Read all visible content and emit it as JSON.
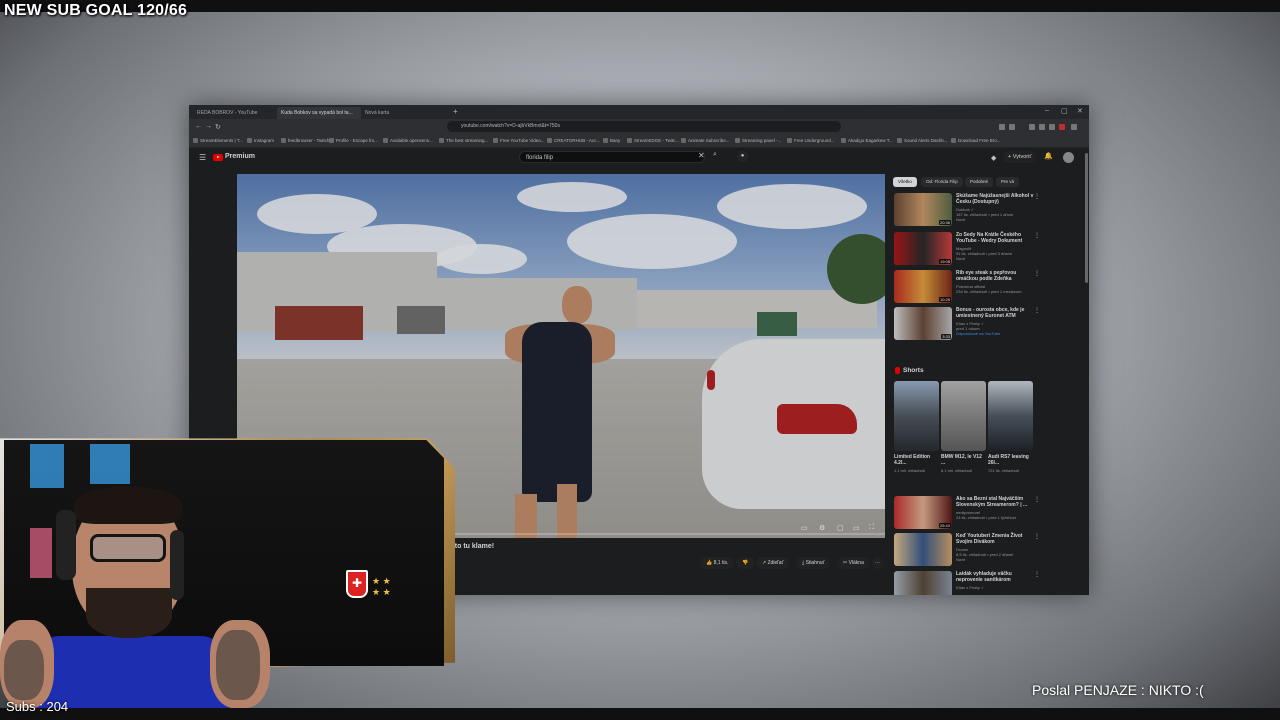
{
  "overlay": {
    "sub_goal": "NEW SUB GOAL 120/66",
    "subs_label": "Subs : 204",
    "donation": "Poslal PENJAZE : NIKTO :("
  },
  "browser": {
    "tabs": [
      "REDA BOBROV - YouTube",
      "Kuda Bobkov sa vypadá bol ta...",
      "Nová karta"
    ],
    "new_tab": "+",
    "window_controls": [
      "–",
      "▢",
      "✕"
    ],
    "url": "youtube.com/watch?v=D-ajbVkBmxt&t=750s",
    "bookmarks": [
      "StreamElements | T...",
      "Instagram",
      "feedbrowser - Twitch",
      "Profile - Escape fro...",
      "Available opensens...",
      "The best streaming...",
      "Free YouTube Video...",
      "CREATORHUB - Acc...",
      "Bany",
      "StreamEDGE - Twitc...",
      "Animate Subscribe...",
      "Streaming panel -...",
      "Free Underground...",
      "Akadigo Eagarkew T...",
      "Sound Alerts Dashb...",
      "Download Free Bro..."
    ]
  },
  "youtube": {
    "premium_label": "Premium",
    "search_value": "florida filip",
    "create_label": "+ Vytvoriť",
    "video_title": "ekto tu klame!",
    "actions": [
      "👍 8,1 tis.",
      "👎",
      "↗ Zdieľať",
      "⤓ Stiahnuť",
      "✂ Vlákna",
      "⋯"
    ],
    "chips": [
      "Všetko",
      "Od: Florida Filip",
      "Podobné",
      "Pre vá"
    ],
    "recommendations": [
      {
        "title": "Skúšame Najúžasnejší Alkohol v Česku (Dostupný)",
        "channel": "Dobkok ✓",
        "meta": "187 tis. zhliadnutí • pred 1 dňom",
        "badge": "Nové",
        "duration": "20:36"
      },
      {
        "title": "Zo Sedy Na Krátle Českého YouTube - Wedry Dokument",
        "channel": "Magnolit",
        "meta": "91 tis. zhliadnutí • pred 3 dňami",
        "badge": "Nové",
        "duration": "19:08"
      },
      {
        "title": "Rib eye steak s pepřovou omáčkou podle Zdeňka",
        "channel": "Potravina official",
        "meta": "234 tis. zhliadnutí • pred 1 mesiacom",
        "badge": "",
        "duration": "10:28"
      },
      {
        "title": "Bonus - ourosta obce, kde je umiestnený Euronet ATM",
        "channel": "Kňaz z Prahy ✓",
        "meta": "pred 1 rokom",
        "badge": "Odporúčané na YouTube",
        "duration": "3:33"
      },
      {
        "title": "Ako sa Bezní stal Najväčším Slovenským Streamerom? | ...",
        "channel": "nedtyvomorel",
        "meta": "24 tis. zhliadnutí • pred 1 týždňom",
        "badge": "",
        "duration": "25:43"
      },
      {
        "title": "Keď Youtuberi Zmenia Život Svojim Divákom",
        "channel": "Droam",
        "meta": "8,5 tis. zhliadnutí • pred 2 dňami",
        "badge": "Nové",
        "duration": ""
      },
      {
        "title": "Laidák vyhladuje väčku neprovenie sanitkárom",
        "channel": "Kňaz z Prahy ✓",
        "meta": "",
        "badge": "",
        "duration": ""
      }
    ],
    "shorts_heading": "Shorts",
    "shorts": [
      {
        "title": "Limited Edition 4.2l...",
        "meta": "1,1 mil. zhliadnutí"
      },
      {
        "title": "BMW M12, le V12 ...",
        "meta": "6,1 mil. zhliadnutí"
      },
      {
        "title": "Audi RS7 leaving 26l...",
        "meta": "721 tis. zhliadnutí"
      }
    ]
  },
  "colors": {
    "yt_dark": "#202124",
    "yt_red": "#ff0000",
    "webcam_frame_gold": "#caa15a",
    "tanktop_blue": "#1d2fb0"
  }
}
